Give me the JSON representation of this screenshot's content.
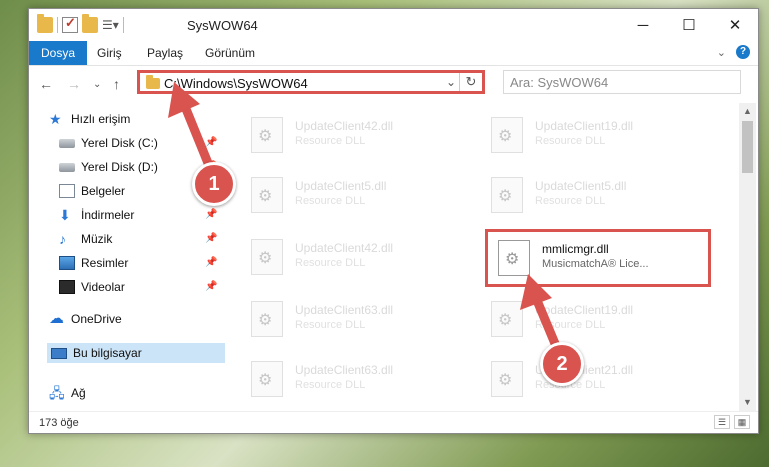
{
  "window": {
    "title": "SysWOW64"
  },
  "ribbon": {
    "tabs": [
      "Dosya",
      "Giriş",
      "Paylaş",
      "Görünüm"
    ],
    "help": "?"
  },
  "nav": {
    "address": "C:\\Windows\\SysWOW64",
    "search_placeholder": "Ara: SysWOW64"
  },
  "sidebar": {
    "items": [
      {
        "label": "Hızlı erişim",
        "icon": "star-icon",
        "pinned": false
      },
      {
        "label": "Yerel Disk (C:)",
        "icon": "disk-icon",
        "pinned": true
      },
      {
        "label": "Yerel Disk (D:)",
        "icon": "disk-icon",
        "pinned": true
      },
      {
        "label": "Belgeler",
        "icon": "document-icon",
        "pinned": true
      },
      {
        "label": "İndirmeler",
        "icon": "download-icon",
        "pinned": true
      },
      {
        "label": "Müzik",
        "icon": "music-icon",
        "pinned": true
      },
      {
        "label": "Resimler",
        "icon": "pictures-icon",
        "pinned": true
      },
      {
        "label": "Videolar",
        "icon": "videos-icon",
        "pinned": true
      },
      {
        "label": "OneDrive",
        "icon": "cloud-icon",
        "pinned": false
      },
      {
        "label": "Bu bilgisayar",
        "icon": "computer-icon",
        "pinned": false,
        "selected": true
      },
      {
        "label": "Ağ",
        "icon": "network-icon",
        "pinned": false
      }
    ]
  },
  "files": [
    {
      "name": "UpdateClient42.dll",
      "desc": "Resource DLL"
    },
    {
      "name": "UpdateClient19.dll",
      "desc": "Resource DLL"
    },
    {
      "name": "UpdateClient5.dll",
      "desc": "Resource DLL"
    },
    {
      "name": "UpdateClient5.dll",
      "desc": "Resource DLL"
    },
    {
      "name": "UpdateClient42.dll",
      "desc": "Resource DLL"
    },
    {
      "name": "mmlicmgr.dll",
      "desc": "MusicmatchA® Lice...",
      "highlighted": true
    },
    {
      "name": "UpdateClient63.dll",
      "desc": "Resource DLL"
    },
    {
      "name": "UpdateClient19.dll",
      "desc": "Resource DLL"
    },
    {
      "name": "UpdateClient63.dll",
      "desc": "Resource DLL"
    },
    {
      "name": "UpdateClient21.dll",
      "desc": "Resource DLL"
    }
  ],
  "status": {
    "count": "173 öğe"
  },
  "annotations": {
    "step1": "1",
    "step2": "2",
    "color": "#d9534f"
  }
}
